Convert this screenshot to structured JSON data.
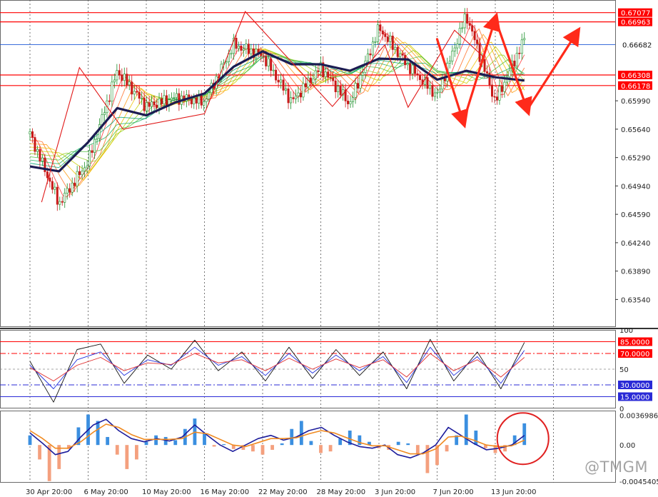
{
  "chart_data": [
    {
      "type": "line",
      "panel": "price",
      "y_ticks": [
        "0.65990",
        "0.65640",
        "0.65290",
        "0.64940",
        "0.64590",
        "0.64240",
        "0.63890",
        "0.63540"
      ],
      "y_ticks_num": [
        0.6599,
        0.6564,
        0.6529,
        0.6494,
        0.6459,
        0.6424,
        0.6389,
        0.6354
      ],
      "ylim": [
        0.632,
        0.6718
      ],
      "x_tick_labels": [
        "30 Apr 20:00",
        "6 May 20:00",
        "10 May 20:00",
        "16 May 20:00",
        "22 May 20:00",
        "28 May 20:00",
        "3 Jun 20:00",
        "7 Jun 20:00",
        "13 Jun 20:00"
      ],
      "x": [
        0,
        0.5,
        1,
        1.5,
        2,
        2.5,
        3,
        3.5,
        4,
        4.5,
        5,
        5.5,
        6,
        6.5,
        7,
        7.5,
        8,
        8.5
      ],
      "series": [
        {
          "values": [
            0.6558,
            0.6472,
            0.6524,
            0.6636,
            0.6592,
            0.6603,
            0.6598,
            0.6668,
            0.6655,
            0.6598,
            0.664,
            0.6595,
            0.6689,
            0.6642,
            0.6605,
            0.6705,
            0.6598,
            0.6675
          ],
          "color": "#202020"
        },
        {
          "values": [
            0.6518,
            0.6512,
            0.6548,
            0.659,
            0.6581,
            0.6597,
            0.6608,
            0.6641,
            0.666,
            0.6644,
            0.6644,
            0.6636,
            0.6651,
            0.665,
            0.6625,
            0.6636,
            0.6628,
            0.6624
          ],
          "color": "#1c1c52"
        }
      ],
      "levels": [
        {
          "value": 0.67077,
          "label": "0.67077",
          "color": "#ff0000"
        },
        {
          "value": 0.66963,
          "label": "0.66963",
          "color": "#ff0000"
        },
        {
          "value": 0.66682,
          "label": "0.66682",
          "color": "#1e5ad6"
        },
        {
          "value": 0.66308,
          "label": "0.66308",
          "color": "#ff0000"
        },
        {
          "value": 0.66178,
          "label": "0.66178",
          "color": "#ff0000"
        }
      ],
      "zigzag": [
        {
          "x": 0.2,
          "y": 0.6474
        },
        {
          "x": 0.85,
          "y": 0.664
        },
        {
          "x": 1.6,
          "y": 0.6564
        },
        {
          "x": 3.0,
          "y": 0.6583
        },
        {
          "x": 3.7,
          "y": 0.6709
        },
        {
          "x": 5.2,
          "y": 0.6592
        },
        {
          "x": 6.1,
          "y": 0.6668
        },
        {
          "x": 6.5,
          "y": 0.6591
        },
        {
          "x": 7.3,
          "y": 0.6686
        },
        {
          "x": 7.8,
          "y": 0.6653
        }
      ],
      "annotation_arrows": [
        {
          "from": {
            "x": 7.0,
            "y": 0.6675
          },
          "to": {
            "x": 7.45,
            "y": 0.6573
          }
        },
        {
          "from": {
            "x": 7.45,
            "y": 0.6573
          },
          "to": {
            "x": 8.0,
            "y": 0.67
          }
        },
        {
          "from": {
            "x": 8.0,
            "y": 0.67
          },
          "to": {
            "x": 8.55,
            "y": 0.6588
          }
        },
        {
          "from": {
            "x": 8.55,
            "y": 0.6588
          },
          "to": {
            "x": 9.4,
            "y": 0.6683
          }
        }
      ]
    },
    {
      "type": "line",
      "panel": "oscillator",
      "ylim": [
        0,
        100
      ],
      "y_ticks": [
        "100",
        "50",
        "0"
      ],
      "y_ticks_num": [
        100,
        50,
        0
      ],
      "levels": [
        {
          "value": 85,
          "label": "85.0000",
          "color": "#ff0000"
        },
        {
          "value": 70,
          "label": "70.0000",
          "color": "#ff0000"
        },
        {
          "value": 30,
          "label": "30.0000",
          "color": "#2a2ad6"
        },
        {
          "value": 15,
          "label": "15.0000",
          "color": "#2a2ad6"
        }
      ],
      "series": [
        {
          "values": [
            60,
            8,
            75,
            82,
            32,
            68,
            50,
            87,
            48,
            72,
            35,
            78,
            38,
            75,
            42,
            72,
            25,
            88,
            35,
            72,
            25,
            84
          ],
          "color": "#111111"
        },
        {
          "values": [
            55,
            25,
            62,
            72,
            42,
            62,
            55,
            78,
            55,
            66,
            42,
            70,
            45,
            68,
            48,
            66,
            33,
            78,
            42,
            66,
            32,
            74
          ],
          "color": "#2233dd"
        },
        {
          "values": [
            52,
            35,
            55,
            65,
            48,
            58,
            56,
            70,
            58,
            62,
            48,
            64,
            50,
            63,
            52,
            62,
            40,
            70,
            48,
            62,
            40,
            65
          ],
          "color": "#e03030"
        }
      ]
    },
    {
      "type": "bar",
      "panel": "macd",
      "ylim": [
        -0.0047,
        0.0042
      ],
      "y_ticks": [
        "0.0036986",
        "0.00",
        "-0.0045405"
      ],
      "y_ticks_num": [
        0.0036986,
        0,
        -0.0045405
      ],
      "values": [
        0.0012,
        -0.0018,
        -0.0045,
        -0.003,
        -0.0005,
        0.0022,
        0.0038,
        0.003,
        0.001,
        -0.0012,
        -0.003,
        -0.0018,
        0.0004,
        0.0012,
        0.001,
        0.0006,
        0.002,
        0.0033,
        0.0015,
        -0.0002,
        0.0001,
        -0.0005,
        -0.0006,
        -0.0008,
        -0.0012,
        -0.0006,
        0.0002,
        0.002,
        0.003,
        0.0005,
        -0.001,
        -0.0008,
        0.0008,
        0.0018,
        0.0012,
        0.0004,
        -0.0004,
        -0.0006,
        0.0004,
        0.0002,
        -0.0012,
        -0.0035,
        -0.0025,
        -0.0008,
        0.0012,
        0.0038,
        0.0018,
        -0.0004,
        -0.001,
        -0.0008,
        0.0012,
        0.0027
      ],
      "positive_color": "#3b8fe0",
      "negative_color": "#f4a07e",
      "series": [
        {
          "values": [
            0.0015,
            0.0002,
            -0.0012,
            -0.0008,
            0.001,
            0.0025,
            0.0032,
            0.0018,
            0.0008,
            0.0004,
            0.0008,
            0.0005,
            0.001,
            0.0025,
            0.0012,
            0.0,
            -0.0008,
            0.0,
            0.0008,
            0.0012,
            0.0006,
            0.001,
            0.0018,
            0.0022,
            0.0012,
            0.0004,
            -0.0002,
            -0.0004,
            0.0,
            -0.0012,
            -0.0016,
            -0.001,
            0.0,
            0.0022,
            0.0012,
            0.0002,
            -0.0006,
            -0.0004,
            0.0,
            0.0012
          ],
          "color": "#1c1c9c"
        },
        {
          "values": [
            0.0018,
            0.0008,
            -0.0004,
            -0.0004,
            0.0004,
            0.0016,
            0.0026,
            0.0022,
            0.0013,
            0.0007,
            0.0007,
            0.0007,
            0.0008,
            0.0016,
            0.0014,
            0.0007,
            0.0,
            -0.0002,
            0.0003,
            0.0008,
            0.0008,
            0.0009,
            0.0014,
            0.0018,
            0.0015,
            0.0009,
            0.0003,
            -0.0001,
            -0.0001,
            -0.0006,
            -0.0011,
            -0.0011,
            -0.0005,
            0.001,
            0.0011,
            0.0006,
            0.0,
            -0.0002,
            -0.0001,
            0.0006
          ],
          "color": "#f08a20"
        }
      ]
    }
  ],
  "watermark": "@TMGM",
  "colors": {
    "grid": "#555555",
    "panel_border": "#6a6a6a",
    "highlight_circle": "#e02020",
    "arrow": "#ff2a1a",
    "ribbon_start": "#ff2a2a",
    "ribbon_end": "#00b050"
  }
}
